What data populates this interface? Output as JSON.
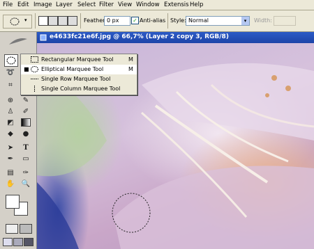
{
  "menu": [
    "File",
    "Edit",
    "Image",
    "Layer",
    "Select",
    "Filter",
    "View",
    "Window",
    "Extensis",
    "Help"
  ],
  "options": {
    "feather_label": "Feather:",
    "feather_value": "0 px",
    "antialias_label": "Anti-alias",
    "style_label": "Style:",
    "style_value": "Normal",
    "width_label": "Width:"
  },
  "document": {
    "title": "e4633fc21e6f.jpg @ 66,7% (Layer 2 copy 3, RGB/8)"
  },
  "flyout": {
    "items": [
      {
        "label": "Rectangular Marquee Tool",
        "shortcut": "M",
        "selected": false
      },
      {
        "label": "Elliptical Marquee Tool",
        "shortcut": "M",
        "selected": true
      },
      {
        "label": "Single Row Marquee Tool",
        "shortcut": "",
        "selected": false
      },
      {
        "label": "Single Column Marquee Tool",
        "shortcut": "",
        "selected": false
      }
    ]
  },
  "tools": [
    "marquee-tool",
    "lasso-tool",
    "crop-tool",
    "healing-brush-tool",
    "brush-tool",
    "clone-stamp-tool",
    "history-brush-tool",
    "eraser-tool",
    "gradient-tool",
    "blur-tool",
    "dodge-tool",
    "path-selection-tool",
    "type-tool",
    "pen-tool",
    "shape-tool",
    "notes-tool",
    "eyedropper-tool",
    "hand-tool",
    "zoom-tool"
  ],
  "colors": {
    "titlebar": "#2c5bc6",
    "menubar": "#ece9d8",
    "toolbox": "#d4d0c8"
  }
}
